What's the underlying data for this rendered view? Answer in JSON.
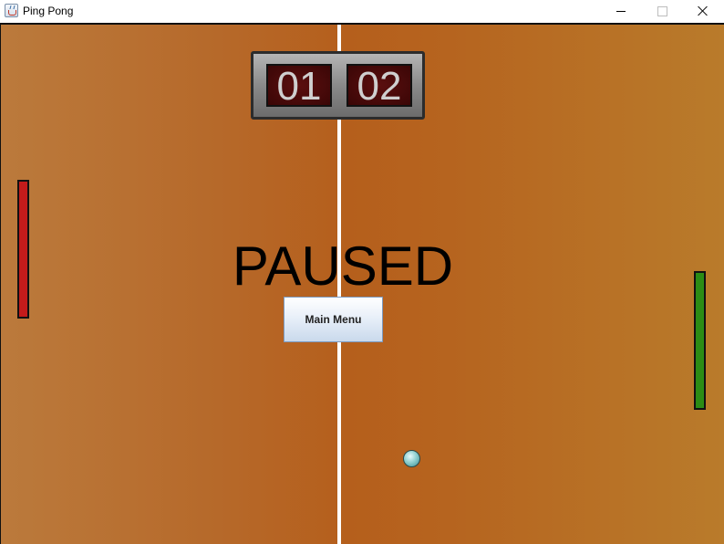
{
  "window": {
    "title": "Ping Pong",
    "icon": "java-cup-icon"
  },
  "score": {
    "left": "01",
    "right": "02"
  },
  "status_text": "PAUSED",
  "menu": {
    "main_menu_label": "Main Menu"
  },
  "colors": {
    "left_paddle": "#c41b1b",
    "right_paddle": "#2c8c15",
    "table": "#b6692a",
    "net": "#ffffff",
    "score_display": "#4a0a0a"
  }
}
